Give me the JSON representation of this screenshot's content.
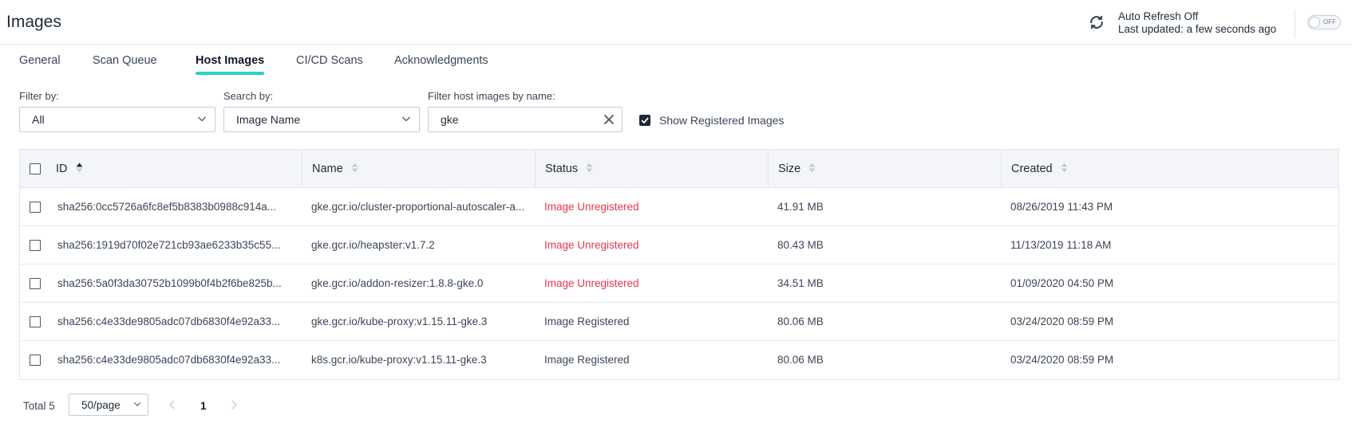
{
  "header": {
    "title": "Images",
    "refresh_status": "Auto Refresh Off",
    "last_updated": "Last updated: a few seconds ago",
    "toggle_label": "OFF"
  },
  "tabs": [
    {
      "label": "General",
      "active": false
    },
    {
      "label": "Scan Queue",
      "active": false
    },
    {
      "label": "Host Images",
      "active": true
    },
    {
      "label": "CI/CD Scans",
      "active": false
    },
    {
      "label": "Acknowledgments",
      "active": false
    }
  ],
  "filters": {
    "filter_by_label": "Filter by:",
    "filter_by_value": "All",
    "search_by_label": "Search by:",
    "search_by_value": "Image Name",
    "name_filter_label": "Filter host images by name:",
    "name_filter_value": "gke",
    "show_registered_label": "Show Registered Images",
    "show_registered_checked": true
  },
  "table": {
    "columns": [
      "ID",
      "Name",
      "Status",
      "Size",
      "Created"
    ],
    "sorted_column": "ID",
    "rows": [
      {
        "id": "sha256:0cc5726a6fc8ef5b8383b0988c914a...",
        "name": "gke.gcr.io/cluster-proportional-autoscaler-a...",
        "status": "Image Unregistered",
        "size": "41.91 MB",
        "created": "08/26/2019 11:43 PM"
      },
      {
        "id": "sha256:1919d70f02e721cb93ae6233b35c55...",
        "name": "gke.gcr.io/heapster:v1.7.2",
        "status": "Image Unregistered",
        "size": "80.43 MB",
        "created": "11/13/2019 11:18 AM"
      },
      {
        "id": "sha256:5a0f3da30752b1099b0f4b2f6be825b...",
        "name": "gke.gcr.io/addon-resizer:1.8.8-gke.0",
        "status": "Image Unregistered",
        "size": "34.51 MB",
        "created": "01/09/2020 04:50 PM"
      },
      {
        "id": "sha256:c4e33de9805adc07db6830f4e92a33...",
        "name": "gke.gcr.io/kube-proxy:v1.15.11-gke.3",
        "status": "Image Registered",
        "size": "80.06 MB",
        "created": "03/24/2020 08:59 PM"
      },
      {
        "id": "sha256:c4e33de9805adc07db6830f4e92a33...",
        "name": "k8s.gcr.io/kube-proxy:v1.15.11-gke.3",
        "status": "Image Registered",
        "size": "80.06 MB",
        "created": "03/24/2020 08:59 PM"
      }
    ]
  },
  "pagination": {
    "total": "Total 5",
    "page_size": "50/page",
    "current_page": "1"
  },
  "colors": {
    "accent": "#25d3c6",
    "unregistered": "#e8364e"
  }
}
